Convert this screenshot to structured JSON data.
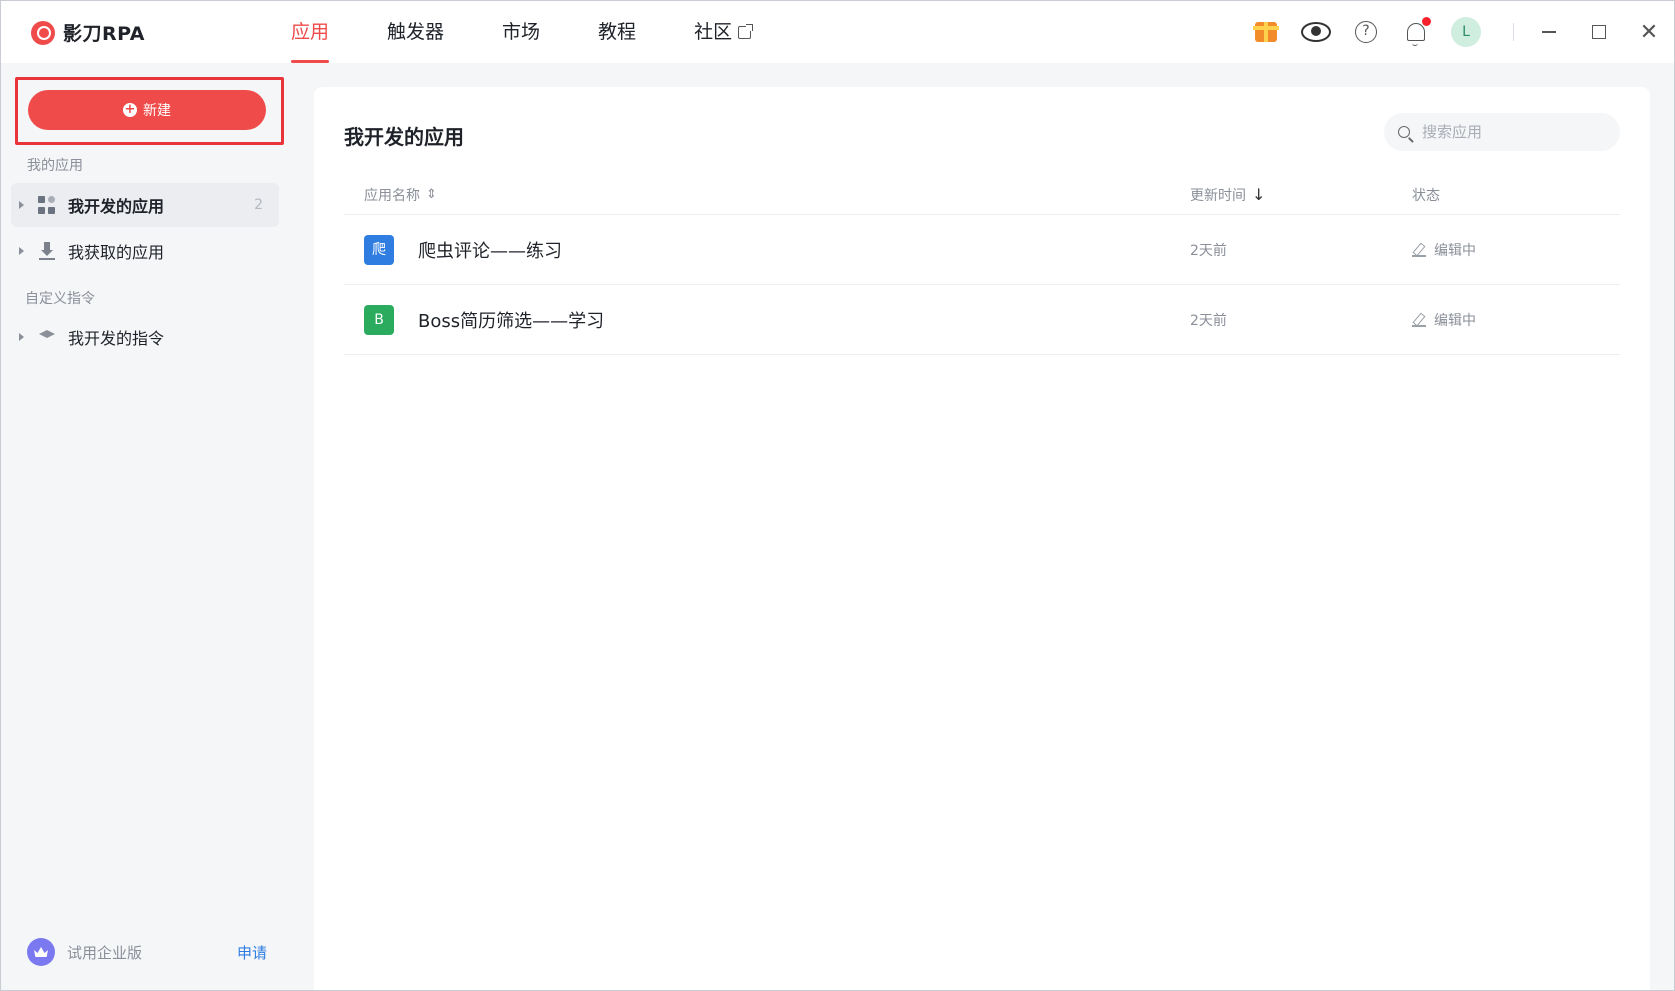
{
  "brand": {
    "name": "影刀RPA",
    "accent": "#f04b4b"
  },
  "nav": {
    "items": [
      {
        "label": "应用",
        "active": true
      },
      {
        "label": "触发器",
        "active": false
      },
      {
        "label": "市场",
        "active": false
      },
      {
        "label": "教程",
        "active": false
      },
      {
        "label": "社区",
        "active": false,
        "icon": "external-link-icon"
      }
    ]
  },
  "topright": {
    "icons": [
      "gift-icon",
      "eye-icon",
      "help-icon",
      "bell-icon"
    ],
    "help_glyph": "?",
    "avatar_letter": "L",
    "has_notification": true
  },
  "window_controls": {
    "close_glyph": "✕"
  },
  "sidebar": {
    "new_button": "新建",
    "section_my_apps": "我的应用",
    "items_apps": [
      {
        "label": "我开发的应用",
        "count": "2",
        "icon": "grid-icon",
        "active": true
      },
      {
        "label": "我获取的应用",
        "count": "",
        "icon": "download-icon",
        "active": false
      }
    ],
    "section_custom": "自定义指令",
    "items_custom": [
      {
        "label": "我开发的指令",
        "icon": "layers-icon",
        "active": false
      }
    ],
    "enterprise_label": "试用企业版",
    "enterprise_apply": "申请"
  },
  "main": {
    "title": "我开发的应用",
    "search_placeholder": "搜索应用",
    "columns": {
      "name": "应用名称",
      "name_sort": "⇕",
      "time": "更新时间",
      "time_sort": "↓",
      "status": "状态"
    },
    "rows": [
      {
        "icon_text": "爬",
        "icon_color": "#2f7de1",
        "name": "爬虫评论——练习",
        "time": "2天前",
        "status": "编辑中"
      },
      {
        "icon_text": "B",
        "icon_color": "#2aab5e",
        "name": "Boss简历筛选——学习",
        "time": "2天前",
        "status": "编辑中"
      }
    ]
  }
}
